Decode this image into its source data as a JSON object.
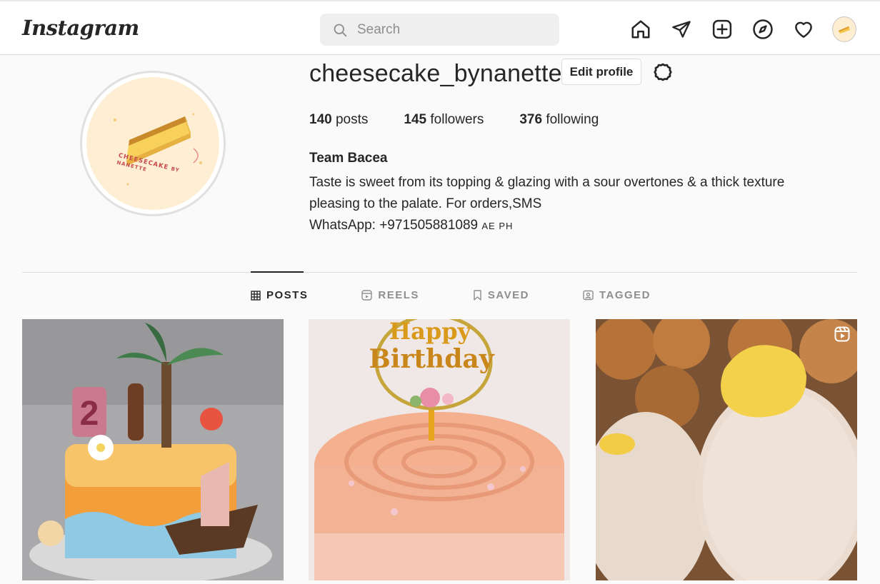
{
  "header": {
    "logo": "Instagram",
    "search_placeholder": "Search",
    "nav_icons": [
      "home-icon",
      "direct-icon",
      "new-post-icon",
      "explore-icon",
      "activity-icon",
      "profile-avatar"
    ]
  },
  "profile": {
    "username": "cheesecake_bynanette",
    "edit_label": "Edit profile",
    "stats": {
      "posts_count": "140",
      "posts_label": " posts",
      "followers_count": "145",
      "followers_label": " followers",
      "following_count": "376",
      "following_label": " following"
    },
    "full_name": "Team Bacea",
    "bio_line1": "Taste is sweet from its topping & glazing with a sour overtones & a thick texture",
    "bio_line2": "pleasing to the palate. For orders,SMS",
    "bio_line3": "WhatsApp: +971505881089 ",
    "bio_flags": "AE PH",
    "avatar_text_1": "CHEESECAKE",
    "avatar_text_2": "BY NANETTE"
  },
  "tabs": [
    {
      "label": "POSTS",
      "active": true
    },
    {
      "label": "REELS",
      "active": false
    },
    {
      "label": "SAVED",
      "active": false
    },
    {
      "label": "TAGGED",
      "active": false
    }
  ],
  "posts": {
    "post1_cake_topper": "2",
    "post2_topper_line1": "Happy",
    "post2_topper_line2": "Birthday"
  },
  "colors": {
    "background": "#fafafa",
    "text": "#262626",
    "muted": "#8e8e8e",
    "border": "#dbdbdb"
  }
}
